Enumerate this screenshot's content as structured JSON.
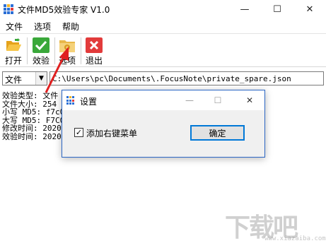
{
  "window": {
    "title": "文件MD5效验专家 V1.0",
    "controls": {
      "minimize": "—",
      "maximize": "☐",
      "close": "✕"
    }
  },
  "menu": [
    "文件",
    "选项",
    "帮助"
  ],
  "toolbar": {
    "items": [
      {
        "label": "打开",
        "icon": "folder-open-icon",
        "color": "#f0b429"
      },
      {
        "label": "效验",
        "icon": "checkmark-icon",
        "color": "#3aa83a"
      },
      {
        "label": "选项",
        "icon": "options-folder-icon",
        "color": "#e8b84a"
      },
      {
        "label": "退出",
        "icon": "exit-x-icon",
        "color": "#e23b3b"
      }
    ]
  },
  "path_row": {
    "type_value": "文件",
    "path_value": "C:\\Users\\pc\\Documents\\.FocusNote\\private_spare.json"
  },
  "output_lines": [
    "效验类型: 文件",
    "文件大小: 254",
    "小写 MD5: f7c0",
    "大写 MD5: F7C0",
    "修改时间: 2020",
    "效验时间: 2020"
  ],
  "dialog": {
    "title": "设置",
    "checkbox_label": "添加右键菜单",
    "checkbox_checked": "✓",
    "ok_label": "确定",
    "controls": {
      "minimize": "—",
      "maximize": "☐",
      "close": "✕"
    }
  },
  "watermark": {
    "text": "下载吧",
    "sub": "www.xiazaiba.com"
  },
  "colors": {
    "accent": "#0078d7",
    "arrow": "#e02020",
    "dialog_border": "#2b66c4"
  }
}
